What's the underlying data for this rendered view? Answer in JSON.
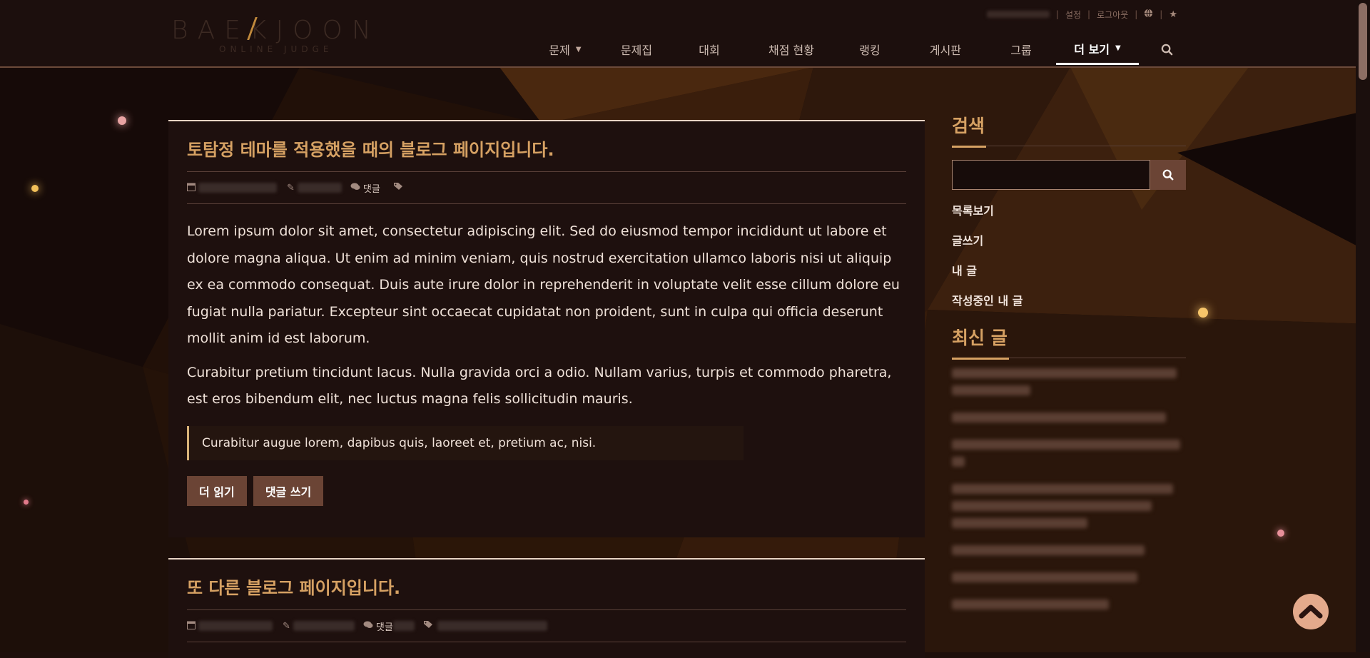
{
  "header": {
    "logo_text": "BAEKJOON",
    "logo_subtext": "ONLINE JUDGE",
    "util_links": [
      "설정",
      "로그아웃"
    ],
    "nav": [
      {
        "label": "문제",
        "has_caret": true
      },
      {
        "label": "문제집",
        "has_caret": false
      },
      {
        "label": "대회",
        "has_caret": false
      },
      {
        "label": "채점 현황",
        "has_caret": false
      },
      {
        "label": "랭킹",
        "has_caret": false
      },
      {
        "label": "게시판",
        "has_caret": false
      },
      {
        "label": "그룹",
        "has_caret": false
      },
      {
        "label": "더 보기",
        "has_caret": true,
        "active": true
      }
    ]
  },
  "posts": [
    {
      "title": "토탐정 테마를 적용했을 때의 블로그 페이지입니다.",
      "meta_comment": "댓글",
      "paragraphs": [
        "Lorem ipsum dolor sit amet, consectetur adipiscing elit. Sed do eiusmod tempor incididunt ut labore et dolore magna aliqua. Ut enim ad minim veniam, quis nostrud exercitation ullamco laboris nisi ut aliquip ex ea commodo consequat. Duis aute irure dolor in reprehenderit in voluptate velit esse cillum dolore eu fugiat nulla pariatur. Excepteur sint occaecat cupidatat non proident, sunt in culpa qui officia deserunt mollit anim id est laborum.",
        "Curabitur pretium tincidunt lacus. Nulla gravida orci a odio. Nullam varius, turpis et commodo pharetra, est eros bibendum elit, nec luctus magna felis sollicitudin mauris."
      ],
      "quote": "Curabitur augue lorem, dapibus quis, laoreet et, pretium ac, nisi.",
      "buttons": [
        "더 읽기",
        "댓글 쓰기"
      ]
    },
    {
      "title": "또 다른 블로그 페이지입니다.",
      "meta_comment": "댓글"
    }
  ],
  "sidebar": {
    "search_heading": "검색",
    "links": [
      "목록보기",
      "글쓰기",
      "내 글",
      "작성중인 내 글"
    ],
    "recent_heading": "최신 글"
  },
  "colors": {
    "accent": "#d6a163",
    "button": "#6b4435",
    "background": "#1e100e"
  },
  "icons": [
    "calendar-icon",
    "pencil-icon",
    "comments-icon",
    "tags-icon",
    "globe-icon",
    "star-icon",
    "search-icon",
    "caret-down-icon",
    "chevron-up-icon"
  ]
}
